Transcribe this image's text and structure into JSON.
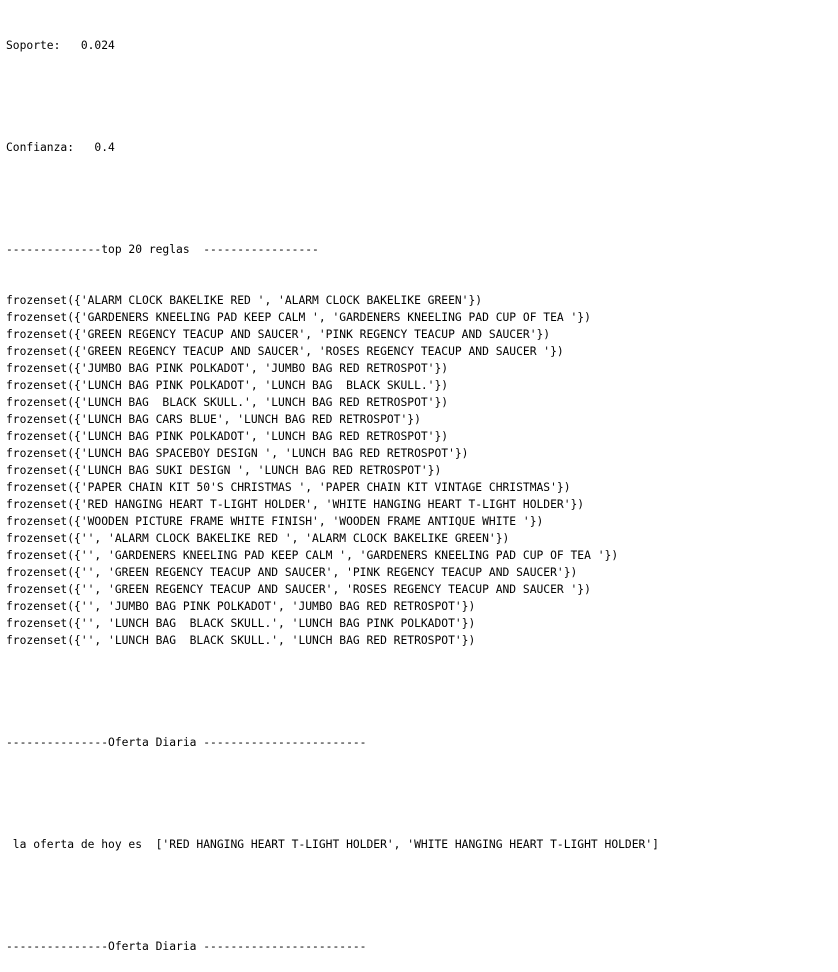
{
  "output": {
    "soporte_line": "Soporte:   0.024",
    "confianza_line": "Confianza:   0.4",
    "top_header": "--------------top 20 reglas  -----------------",
    "rules": [
      "frozenset({'ALARM CLOCK BAKELIKE RED ', 'ALARM CLOCK BAKELIKE GREEN'})",
      "frozenset({'GARDENERS KNEELING PAD KEEP CALM ', 'GARDENERS KNEELING PAD CUP OF TEA '})",
      "frozenset({'GREEN REGENCY TEACUP AND SAUCER', 'PINK REGENCY TEACUP AND SAUCER'})",
      "frozenset({'GREEN REGENCY TEACUP AND SAUCER', 'ROSES REGENCY TEACUP AND SAUCER '})",
      "frozenset({'JUMBO BAG PINK POLKADOT', 'JUMBO BAG RED RETROSPOT'})",
      "frozenset({'LUNCH BAG PINK POLKADOT', 'LUNCH BAG  BLACK SKULL.'})",
      "frozenset({'LUNCH BAG  BLACK SKULL.', 'LUNCH BAG RED RETROSPOT'})",
      "frozenset({'LUNCH BAG CARS BLUE', 'LUNCH BAG RED RETROSPOT'})",
      "frozenset({'LUNCH BAG PINK POLKADOT', 'LUNCH BAG RED RETROSPOT'})",
      "frozenset({'LUNCH BAG SPACEBOY DESIGN ', 'LUNCH BAG RED RETROSPOT'})",
      "frozenset({'LUNCH BAG SUKI DESIGN ', 'LUNCH BAG RED RETROSPOT'})",
      "frozenset({'PAPER CHAIN KIT 50'S CHRISTMAS ', 'PAPER CHAIN KIT VINTAGE CHRISTMAS'})",
      "frozenset({'RED HANGING HEART T-LIGHT HOLDER', 'WHITE HANGING HEART T-LIGHT HOLDER'})",
      "frozenset({'WOODEN PICTURE FRAME WHITE FINISH', 'WOODEN FRAME ANTIQUE WHITE '})",
      "frozenset({'', 'ALARM CLOCK BAKELIKE RED ', 'ALARM CLOCK BAKELIKE GREEN'})",
      "frozenset({'', 'GARDENERS KNEELING PAD KEEP CALM ', 'GARDENERS KNEELING PAD CUP OF TEA '})",
      "frozenset({'', 'GREEN REGENCY TEACUP AND SAUCER', 'PINK REGENCY TEACUP AND SAUCER'})",
      "frozenset({'', 'GREEN REGENCY TEACUP AND SAUCER', 'ROSES REGENCY TEACUP AND SAUCER '})",
      "frozenset({'', 'JUMBO BAG PINK POLKADOT', 'JUMBO BAG RED RETROSPOT'})",
      "frozenset({'', 'LUNCH BAG  BLACK SKULL.', 'LUNCH BAG PINK POLKADOT'})",
      "frozenset({'', 'LUNCH BAG  BLACK SKULL.', 'LUNCH BAG RED RETROSPOT'})"
    ],
    "oferta_header_1": "---------------Oferta Diaria ------------------------",
    "oferta_line": " la oferta de hoy es  ['RED HANGING HEART T-LIGHT HOLDER', 'WHITE HANGING HEART T-LIGHT HOLDER']",
    "oferta_header_2": "---------------Oferta Diaria ------------------------"
  }
}
